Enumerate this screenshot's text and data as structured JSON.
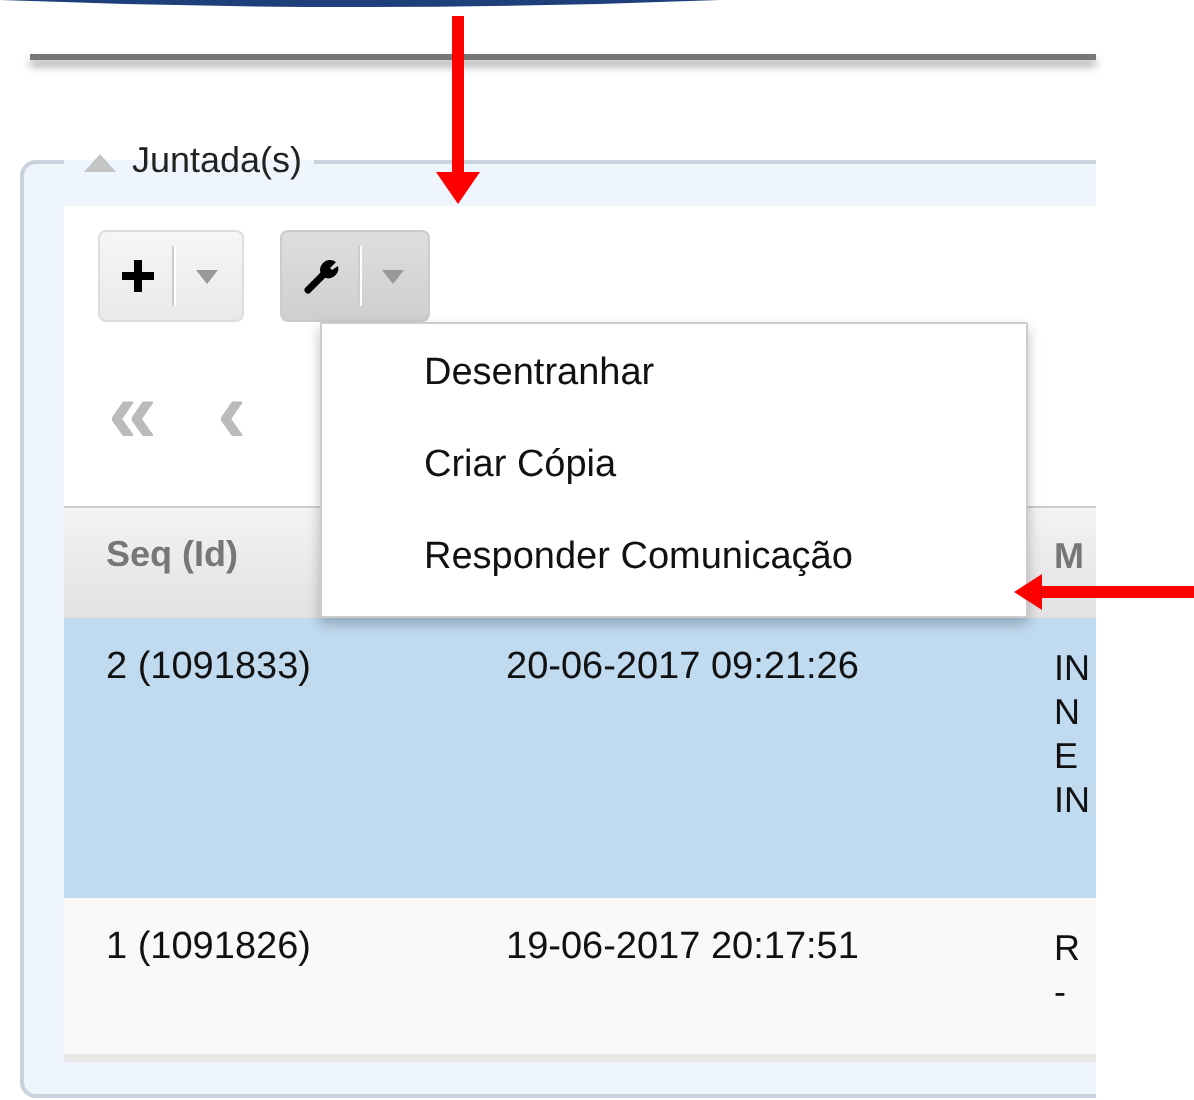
{
  "panel": {
    "legend": "Juntada(s)",
    "expanded": true
  },
  "toolbar": {
    "buttons": [
      {
        "kind": "add",
        "pressed": false
      },
      {
        "kind": "tools",
        "pressed": true
      }
    ]
  },
  "menu": {
    "items": [
      {
        "label": "Desentranhar"
      },
      {
        "label": "Criar Cópia"
      },
      {
        "label": "Responder Comunicação"
      }
    ]
  },
  "pager": [
    "«",
    "‹"
  ],
  "table": {
    "columns": [
      "Seq (Id)",
      "M"
    ],
    "rows": [
      {
        "seq": "2 (1091833)",
        "date": "20-06-2017 09:21:26",
        "column_3": [
          "IN",
          "N",
          "E",
          "IN"
        ],
        "selected": true
      },
      {
        "seq": "1 (1091826)",
        "date": "19-06-2017 20:17:51",
        "column_3": [
          "R",
          "-"
        ],
        "selected": false
      }
    ]
  }
}
